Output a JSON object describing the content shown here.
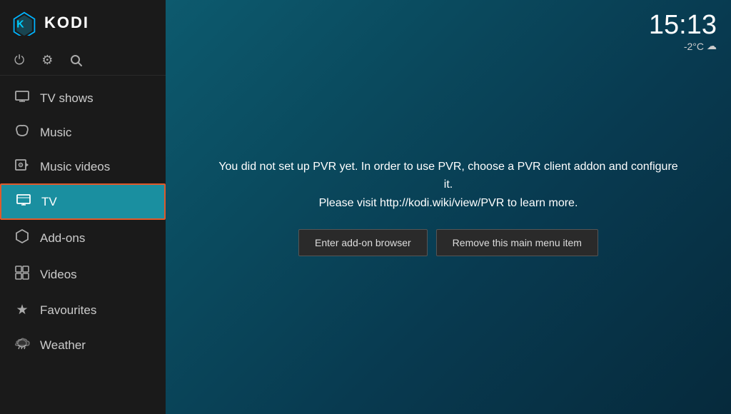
{
  "app": {
    "name": "KODI"
  },
  "time": {
    "display": "15:13",
    "temperature": "-2°C",
    "weather_icon": "cloud"
  },
  "sidebar": {
    "icons": [
      {
        "name": "power-icon",
        "symbol": "⏻",
        "label": "Power"
      },
      {
        "name": "settings-icon",
        "symbol": "⚙",
        "label": "Settings"
      },
      {
        "name": "search-icon",
        "symbol": "🔍",
        "label": "Search"
      }
    ],
    "nav_items": [
      {
        "id": "tv-shows",
        "label": "TV shows",
        "icon": "▭",
        "active": false
      },
      {
        "id": "music",
        "label": "Music",
        "icon": "🎧",
        "active": false
      },
      {
        "id": "music-videos",
        "label": "Music videos",
        "icon": "🎬",
        "active": false
      },
      {
        "id": "tv",
        "label": "TV",
        "icon": "📺",
        "active": true
      },
      {
        "id": "add-ons",
        "label": "Add-ons",
        "icon": "⬡",
        "active": false
      },
      {
        "id": "videos",
        "label": "Videos",
        "icon": "⊞",
        "active": false
      },
      {
        "id": "favourites",
        "label": "Favourites",
        "icon": "★",
        "active": false
      },
      {
        "id": "weather",
        "label": "Weather",
        "icon": "⛅",
        "active": false
      }
    ]
  },
  "main": {
    "pvr_message_line1": "You did not set up PVR yet. In order to use PVR, choose a PVR client addon and configure it.",
    "pvr_message_line2": "Please visit http://kodi.wiki/view/PVR to learn more.",
    "btn_enter_addon": "Enter add-on browser",
    "btn_remove_item": "Remove this main menu item"
  }
}
